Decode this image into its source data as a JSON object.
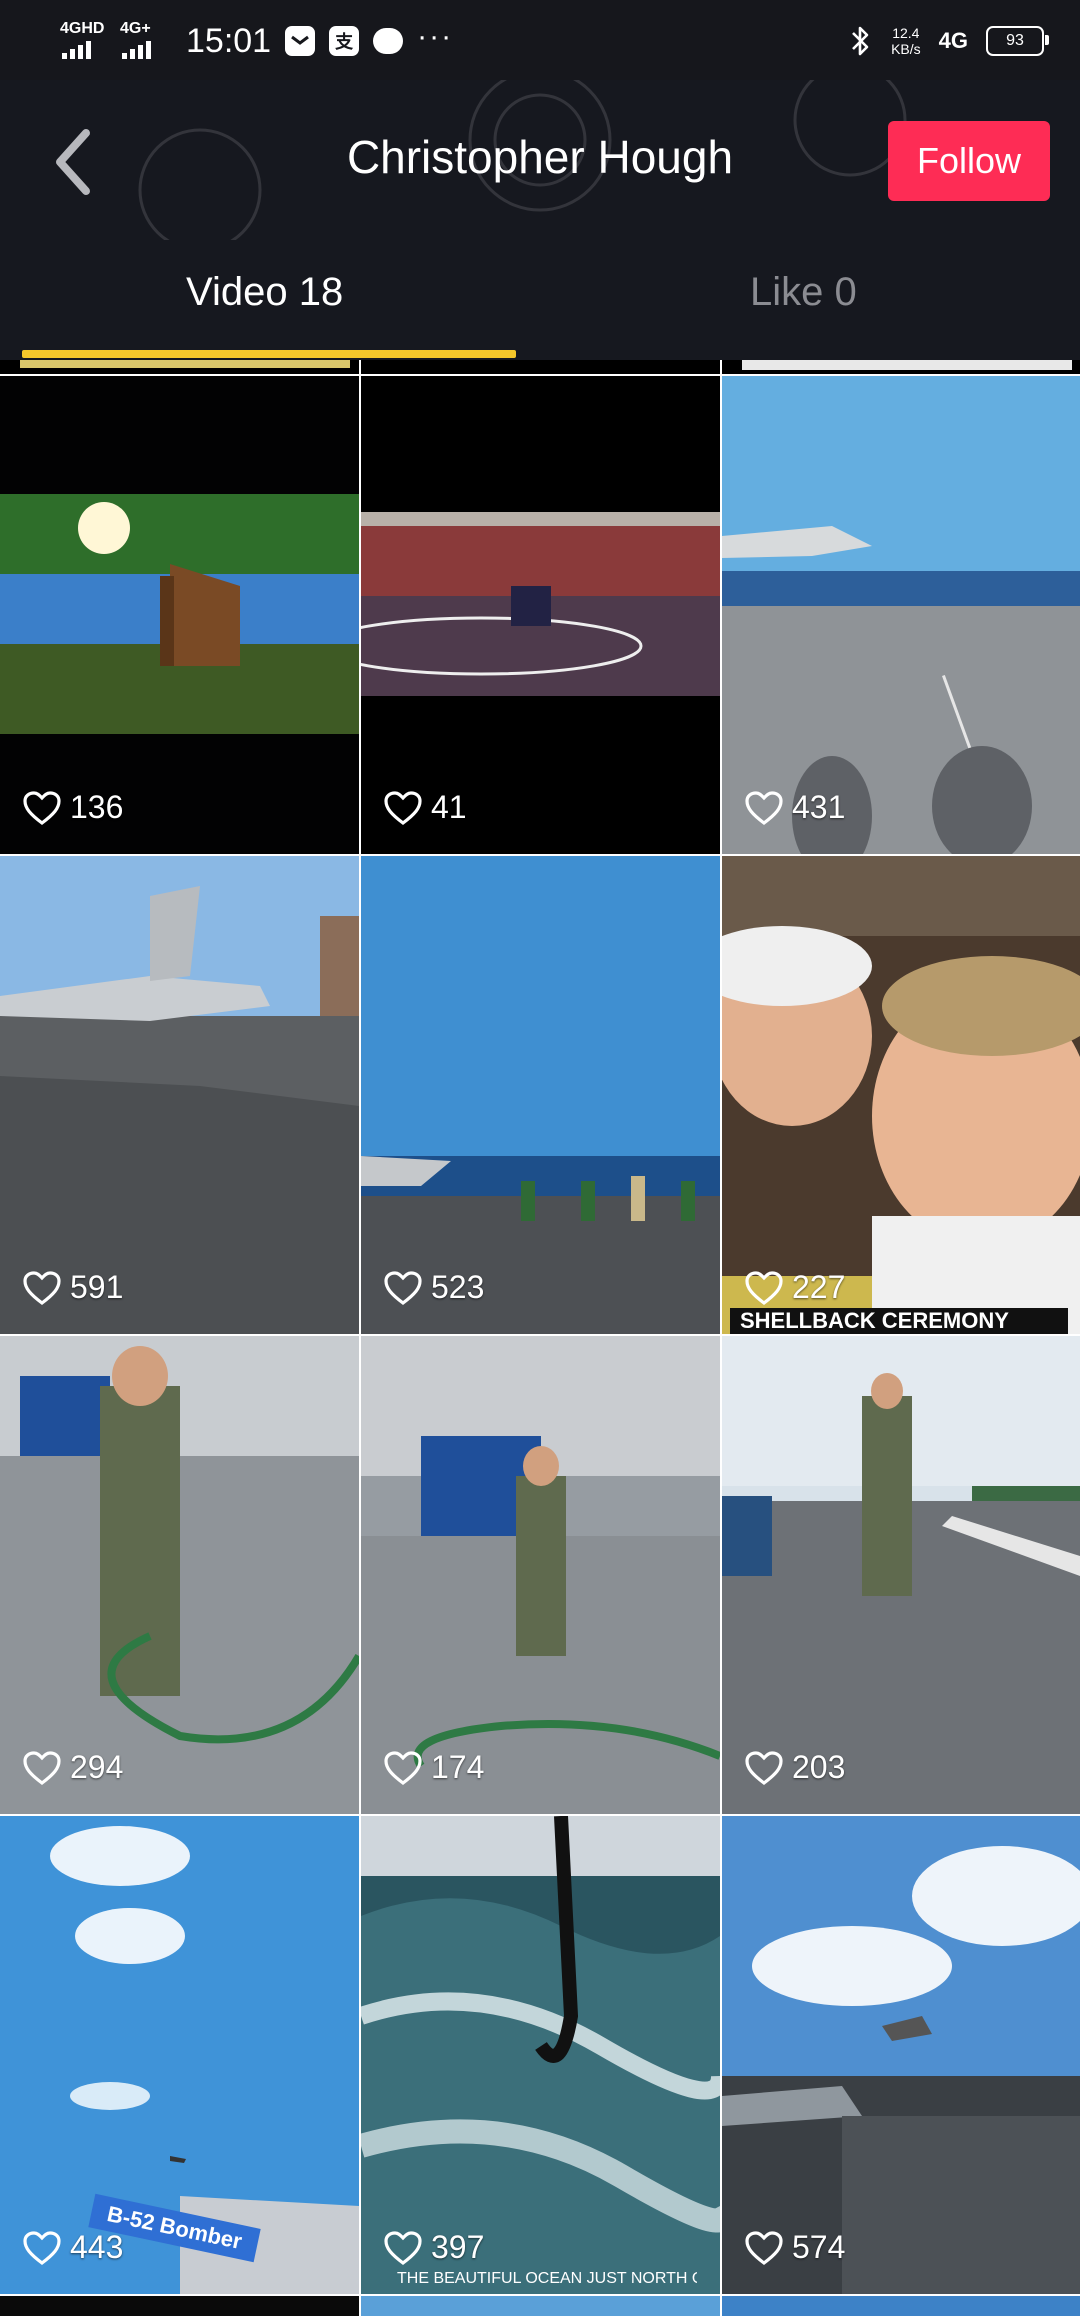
{
  "status_bar": {
    "network_1": "4GHD",
    "network_2": "4G+",
    "time": "15:01",
    "app_icon_label": "支",
    "speed_value": "12.4",
    "speed_unit": "KB/s",
    "network_3": "4G",
    "battery": "93"
  },
  "header": {
    "title": "Christopher Hough",
    "follow_label": "Follow"
  },
  "tabs": {
    "video_label": "Video 18",
    "like_label": "Like 0"
  },
  "videos": [
    {
      "likes": "136"
    },
    {
      "likes": "41"
    },
    {
      "likes": "431"
    },
    {
      "likes": "591"
    },
    {
      "likes": "523"
    },
    {
      "likes": "227",
      "caption": "SHELLBACK CEREMONY"
    },
    {
      "likes": "294"
    },
    {
      "likes": "174"
    },
    {
      "likes": "203"
    },
    {
      "likes": "443",
      "caption": "B-52 Bomber"
    },
    {
      "likes": "397",
      "caption": "THE BEAUTIFUL OCEAN JUST NORTH OF"
    },
    {
      "likes": "574"
    }
  ],
  "colors": {
    "follow": "#fe2c55",
    "tab_indicator": "#f5c72b",
    "background": "#16181f"
  }
}
